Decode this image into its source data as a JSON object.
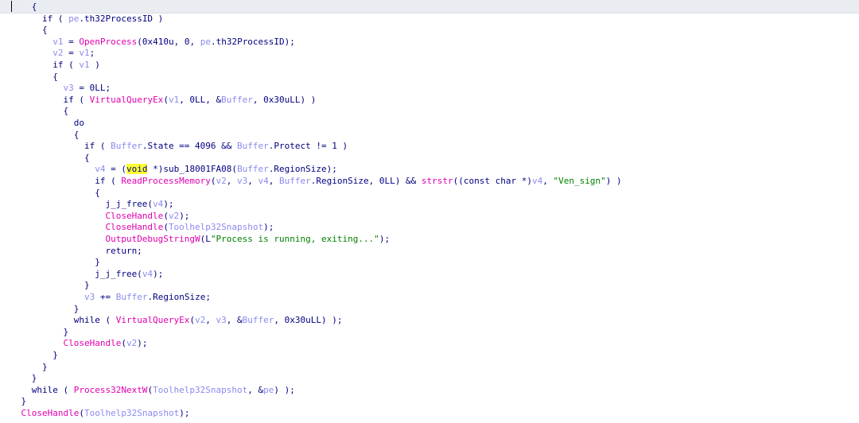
{
  "editor": {
    "caret_line": 1,
    "lines": [
      [
        {
          "t": "      {",
          "c": "op"
        }
      ],
      [
        {
          "t": "        if ( ",
          "c": "kw"
        },
        {
          "t": "pe",
          "c": "var"
        },
        {
          "t": ".th32ProcessID )",
          "c": "op"
        }
      ],
      [
        {
          "t": "        {",
          "c": "op"
        }
      ],
      [
        {
          "t": "          ",
          "c": "op"
        },
        {
          "t": "v1",
          "c": "var"
        },
        {
          "t": " = ",
          "c": "op"
        },
        {
          "t": "OpenProcess",
          "c": "fn"
        },
        {
          "t": "(0x410u, 0, ",
          "c": "op"
        },
        {
          "t": "pe",
          "c": "var"
        },
        {
          "t": ".th32ProcessID);",
          "c": "op"
        }
      ],
      [
        {
          "t": "          ",
          "c": "op"
        },
        {
          "t": "v2",
          "c": "var"
        },
        {
          "t": " = ",
          "c": "op"
        },
        {
          "t": "v1",
          "c": "var"
        },
        {
          "t": ";",
          "c": "op"
        }
      ],
      [
        {
          "t": "          if ( ",
          "c": "kw"
        },
        {
          "t": "v1",
          "c": "var"
        },
        {
          "t": " )",
          "c": "op"
        }
      ],
      [
        {
          "t": "          {",
          "c": "op"
        }
      ],
      [
        {
          "t": "            ",
          "c": "op"
        },
        {
          "t": "v3",
          "c": "var"
        },
        {
          "t": " = 0LL;",
          "c": "op"
        }
      ],
      [
        {
          "t": "            if ( ",
          "c": "kw"
        },
        {
          "t": "VirtualQueryEx",
          "c": "fn"
        },
        {
          "t": "(",
          "c": "op"
        },
        {
          "t": "v1",
          "c": "var"
        },
        {
          "t": ", 0LL, &",
          "c": "op"
        },
        {
          "t": "Buffer",
          "c": "var"
        },
        {
          "t": ", 0x30uLL) )",
          "c": "op"
        }
      ],
      [
        {
          "t": "            {",
          "c": "op"
        }
      ],
      [
        {
          "t": "              do",
          "c": "kw"
        }
      ],
      [
        {
          "t": "              {",
          "c": "op"
        }
      ],
      [
        {
          "t": "                if ( ",
          "c": "kw"
        },
        {
          "t": "Buffer",
          "c": "var"
        },
        {
          "t": ".State == 4096 && ",
          "c": "op"
        },
        {
          "t": "Buffer",
          "c": "var"
        },
        {
          "t": ".Protect != 1 )",
          "c": "op"
        }
      ],
      [
        {
          "t": "                {",
          "c": "op"
        }
      ],
      [
        {
          "t": "                  ",
          "c": "op"
        },
        {
          "t": "v4",
          "c": "var"
        },
        {
          "t": " = (",
          "c": "op"
        },
        {
          "t": "void",
          "c": "hlkw"
        },
        {
          "t": " *)sub_18001FA08(",
          "c": "op"
        },
        {
          "t": "Buffer",
          "c": "var"
        },
        {
          "t": ".RegionSize);",
          "c": "op"
        }
      ],
      [
        {
          "t": "                  if ( ",
          "c": "kw"
        },
        {
          "t": "ReadProcessMemory",
          "c": "fn"
        },
        {
          "t": "(",
          "c": "op"
        },
        {
          "t": "v2",
          "c": "var"
        },
        {
          "t": ", ",
          "c": "op"
        },
        {
          "t": "v3",
          "c": "var"
        },
        {
          "t": ", ",
          "c": "op"
        },
        {
          "t": "v4",
          "c": "var"
        },
        {
          "t": ", ",
          "c": "op"
        },
        {
          "t": "Buffer",
          "c": "var"
        },
        {
          "t": ".RegionSize, 0LL) && ",
          "c": "op"
        },
        {
          "t": "strstr",
          "c": "fn"
        },
        {
          "t": "((const char *)",
          "c": "op"
        },
        {
          "t": "v4",
          "c": "var"
        },
        {
          "t": ", ",
          "c": "op"
        },
        {
          "t": "\"Ven_sign\"",
          "c": "str"
        },
        {
          "t": ") )",
          "c": "op"
        }
      ],
      [
        {
          "t": "                  {",
          "c": "op"
        }
      ],
      [
        {
          "t": "                    j_j_free(",
          "c": "lib"
        },
        {
          "t": "v4",
          "c": "var"
        },
        {
          "t": ");",
          "c": "op"
        }
      ],
      [
        {
          "t": "                    ",
          "c": "op"
        },
        {
          "t": "CloseHandle",
          "c": "fn"
        },
        {
          "t": "(",
          "c": "op"
        },
        {
          "t": "v2",
          "c": "var"
        },
        {
          "t": ");",
          "c": "op"
        }
      ],
      [
        {
          "t": "                    ",
          "c": "op"
        },
        {
          "t": "CloseHandle",
          "c": "fn"
        },
        {
          "t": "(",
          "c": "op"
        },
        {
          "t": "Toolhelp32Snapshot",
          "c": "var"
        },
        {
          "t": ");",
          "c": "op"
        }
      ],
      [
        {
          "t": "                    ",
          "c": "op"
        },
        {
          "t": "OutputDebugStringW",
          "c": "fn"
        },
        {
          "t": "(L",
          "c": "op"
        },
        {
          "t": "\"Process is running, exiting...\"",
          "c": "str"
        },
        {
          "t": ");",
          "c": "op"
        }
      ],
      [
        {
          "t": "                    return;",
          "c": "kw"
        }
      ],
      [
        {
          "t": "                  }",
          "c": "op"
        }
      ],
      [
        {
          "t": "                  j_j_free(",
          "c": "lib"
        },
        {
          "t": "v4",
          "c": "var"
        },
        {
          "t": ");",
          "c": "op"
        }
      ],
      [
        {
          "t": "                }",
          "c": "op"
        }
      ],
      [
        {
          "t": "                ",
          "c": "op"
        },
        {
          "t": "v3",
          "c": "var"
        },
        {
          "t": " += ",
          "c": "op"
        },
        {
          "t": "Buffer",
          "c": "var"
        },
        {
          "t": ".RegionSize;",
          "c": "op"
        }
      ],
      [
        {
          "t": "              }",
          "c": "op"
        }
      ],
      [
        {
          "t": "              while ( ",
          "c": "kw"
        },
        {
          "t": "VirtualQueryEx",
          "c": "fn"
        },
        {
          "t": "(",
          "c": "op"
        },
        {
          "t": "v2",
          "c": "var"
        },
        {
          "t": ", ",
          "c": "op"
        },
        {
          "t": "v3",
          "c": "var"
        },
        {
          "t": ", &",
          "c": "op"
        },
        {
          "t": "Buffer",
          "c": "var"
        },
        {
          "t": ", 0x30uLL) );",
          "c": "op"
        }
      ],
      [
        {
          "t": "            }",
          "c": "op"
        }
      ],
      [
        {
          "t": "            ",
          "c": "op"
        },
        {
          "t": "CloseHandle",
          "c": "fn"
        },
        {
          "t": "(",
          "c": "op"
        },
        {
          "t": "v2",
          "c": "var"
        },
        {
          "t": ");",
          "c": "op"
        }
      ],
      [
        {
          "t": "          }",
          "c": "op"
        }
      ],
      [
        {
          "t": "        }",
          "c": "op"
        }
      ],
      [
        {
          "t": "      }",
          "c": "op"
        }
      ],
      [
        {
          "t": "      while ( ",
          "c": "kw"
        },
        {
          "t": "Process32NextW",
          "c": "fn"
        },
        {
          "t": "(",
          "c": "op"
        },
        {
          "t": "Toolhelp32Snapshot",
          "c": "var"
        },
        {
          "t": ", &",
          "c": "op"
        },
        {
          "t": "pe",
          "c": "var"
        },
        {
          "t": ") );",
          "c": "op"
        }
      ],
      [
        {
          "t": "    }",
          "c": "op"
        }
      ],
      [
        {
          "t": "    ",
          "c": "op"
        },
        {
          "t": "CloseHandle",
          "c": "fn"
        },
        {
          "t": "(",
          "c": "op"
        },
        {
          "t": "Toolhelp32Snapshot",
          "c": "var"
        },
        {
          "t": ");",
          "c": "op"
        }
      ]
    ]
  }
}
